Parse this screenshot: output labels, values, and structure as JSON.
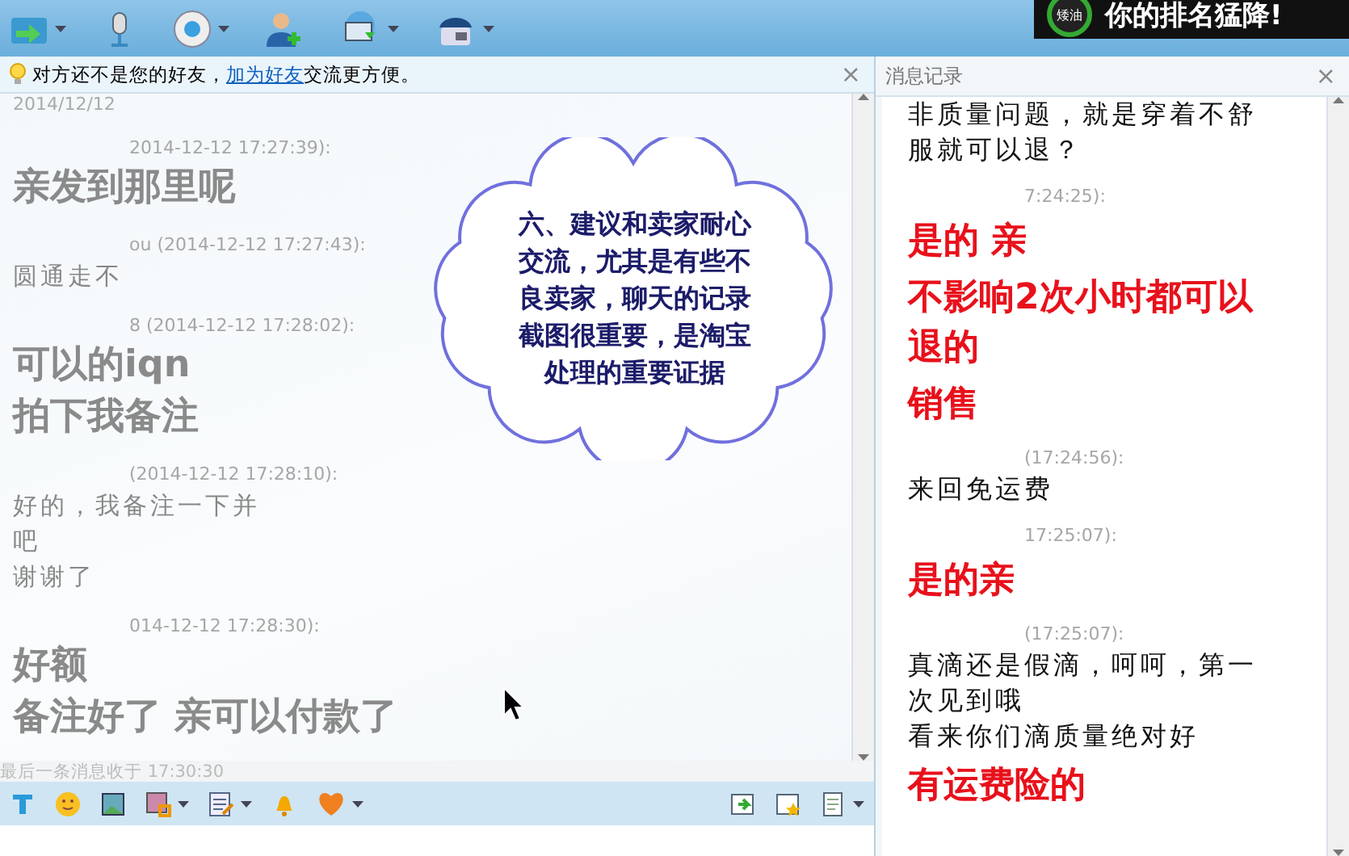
{
  "banner": {
    "badge": "矮油",
    "text": "你的排名猛降!"
  },
  "notice": {
    "before": "对方还不是您的好友，",
    "link": "加为好友",
    "after": "交流更方便。",
    "close": "×"
  },
  "chat": {
    "date": "2014/12/12",
    "messages": [
      {
        "header": "2014-12-12 17:27:39):",
        "kind": "bold",
        "lines": [
          "亲发到那里呢"
        ]
      },
      {
        "header": "ou (2014-12-12 17:27:43):",
        "kind": "plain",
        "lines": [
          "圆通走不"
        ]
      },
      {
        "header": "8 (2014-12-12 17:28:02):",
        "kind": "bold",
        "lines": [
          "可以的iqn",
          "拍下我备注"
        ]
      },
      {
        "header": "(2014-12-12 17:28:10):",
        "kind": "plain",
        "lines": [
          "好的，我备注一下并",
          "吧",
          "谢谢了"
        ]
      },
      {
        "header": "014-12-12 17:28:30):",
        "kind": "bold",
        "lines": [
          "好额",
          "备注好了 亲可以付款了"
        ]
      }
    ],
    "status": "最后一条消息收于 17:30:30"
  },
  "callout": {
    "text": "六、建议和卖家耐心交流，尤其是有些不良卖家，聊天的记录截图很重要，是淘宝处理的重要证据"
  },
  "history": {
    "title": "消息记录",
    "close": "×",
    "messages": [
      {
        "kind": "plain",
        "lines": [
          "非质量问题，就是穿着不舒服就可以退？"
        ]
      },
      {
        "header": "7:24:25):",
        "kind": "bold",
        "lines": [
          "是的 亲",
          "不影响2次小时都可以退的",
          "销售"
        ]
      },
      {
        "header": "(17:24:56):",
        "kind": "plain",
        "lines": [
          "来回免运费"
        ]
      },
      {
        "header": "17:25:07):",
        "kind": "bold",
        "lines": [
          "是的亲"
        ]
      },
      {
        "header": "(17:25:07):",
        "kind": "plain",
        "lines": [
          "真滴还是假滴，呵呵，第一次见到哦",
          "看来你们滴质量绝对好"
        ]
      },
      {
        "kind": "bold",
        "lines": [
          "有运费险的"
        ]
      }
    ]
  }
}
